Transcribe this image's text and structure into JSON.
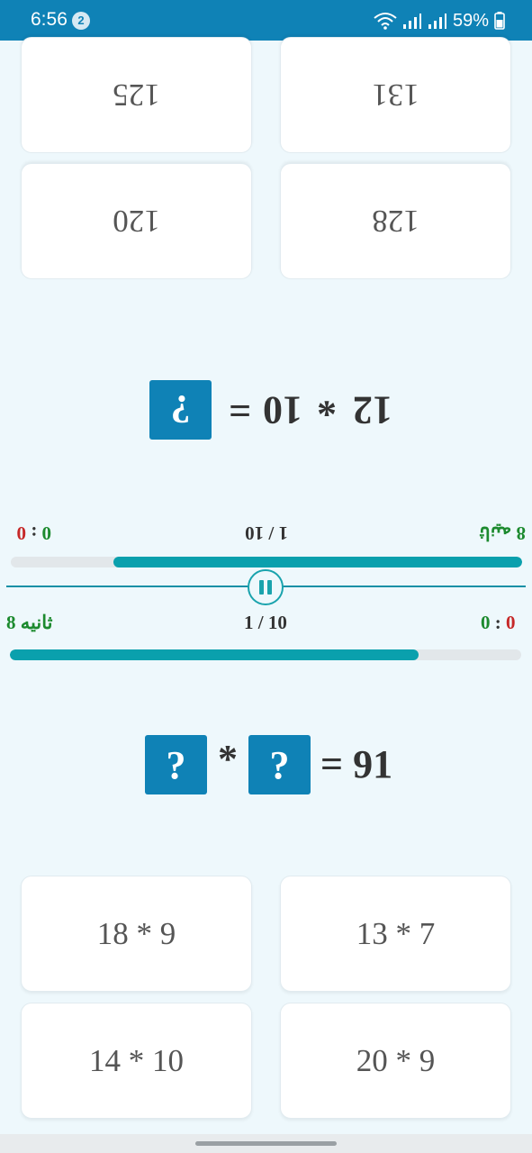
{
  "status_bar": {
    "time": "6:56",
    "notification_count": "2",
    "battery": "59%"
  },
  "top_player": {
    "answers": [
      "128",
      "120",
      "131",
      "125"
    ],
    "equation": {
      "a": "12",
      "operator": "*",
      "b": "10",
      "equals": "=",
      "unknown": "?"
    },
    "progress_fraction": 0.8,
    "score": {
      "right": "0",
      "separator": ":",
      "wrong": "0"
    },
    "round": "1 / 10",
    "timer": "8 ثانیه"
  },
  "bottom_player": {
    "timer": "8 ثانیه",
    "round": "1 / 10",
    "score": {
      "wrong": "0",
      "separator": ":",
      "right": "0"
    },
    "progress_fraction": 0.8,
    "equation": {
      "unknown_a": "?",
      "operator": "*",
      "unknown_b": "?",
      "equals": "= 91"
    },
    "answers": [
      "18 * 9",
      "13 * 7",
      "14 * 10",
      "20 * 9"
    ]
  },
  "colors": {
    "accent": "#0f82b6",
    "progress": "#0aa0ad",
    "right": "#1c8a2e",
    "wrong": "#c62828"
  },
  "icons": {
    "pause": "pause-icon",
    "wifi": "wifi-icon",
    "signal": "signal-icon",
    "battery": "battery-icon"
  }
}
